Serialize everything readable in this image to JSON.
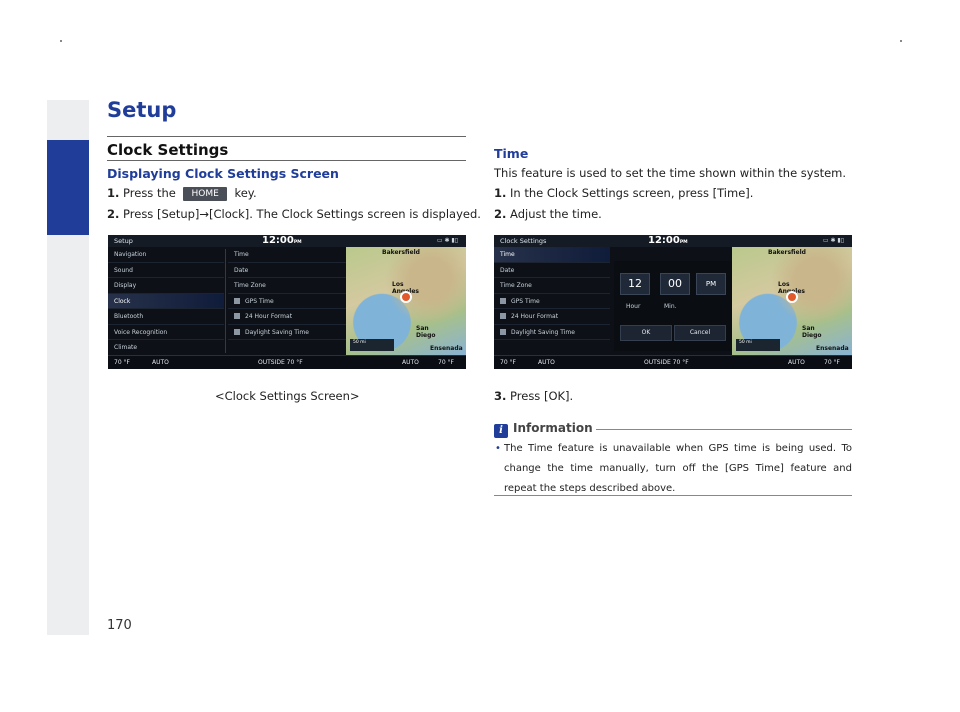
{
  "page": {
    "number": "170",
    "section": "Setup"
  },
  "left": {
    "heading": "Clock Settings",
    "subheading": "Displaying Clock Settings Screen",
    "step1": {
      "num": "1.",
      "before": "Press the",
      "key": "HOME",
      "after": "key."
    },
    "step2": {
      "num": "2.",
      "text": "Press [Setup]→[Clock]. The Clock Settings screen is displayed."
    },
    "caption": "<Clock Settings Screen>"
  },
  "screen1": {
    "title": "Setup",
    "clock": "12:00",
    "ampm": "PM",
    "menu": [
      "Navigation",
      "Sound",
      "Display",
      "Clock",
      "Bluetooth",
      "Voice Recognition",
      "Climate"
    ],
    "active_index": 3,
    "options": [
      {
        "label": "Time",
        "checkbox": false
      },
      {
        "label": "Date",
        "checkbox": false
      },
      {
        "label": "Time Zone",
        "checkbox": false
      },
      {
        "label": "GPS Time",
        "checkbox": true
      },
      {
        "label": "24 Hour Format",
        "checkbox": true
      },
      {
        "label": "Daylight Saving Time",
        "checkbox": true
      }
    ],
    "map": {
      "city1": "Bakersfield",
      "city2": "Los Angeles",
      "city3": "San Diego",
      "city4": "Ensenada",
      "scale": "50 mi"
    },
    "bottom": {
      "temp_left": "70 °F",
      "auto_left": "AUTO",
      "outside": "OUTSIDE  70 °F",
      "auto_right": "AUTO",
      "temp_right": "70 °F"
    }
  },
  "right": {
    "heading": "Time",
    "intro": "This feature is used to set the time shown within the system.",
    "step1": {
      "num": "1.",
      "text": "In the Clock Settings screen, press [Time]."
    },
    "step2": {
      "num": "2.",
      "text": "Adjust the time."
    },
    "step3": {
      "num": "3.",
      "text": "Press [OK]."
    },
    "info_title": "Information",
    "info_text": "The Time feature is unavailable when GPS time is being used. To change the time manually, turn off the [GPS Time] feature and repeat the steps described above."
  },
  "screen2": {
    "title": "Clock Settings",
    "clock": "12:00",
    "ampm": "PM",
    "options": [
      {
        "label": "Time",
        "checkbox": false
      },
      {
        "label": "Date",
        "checkbox": false
      },
      {
        "label": "Time Zone",
        "checkbox": false
      },
      {
        "label": "GPS Time",
        "checkbox": true
      },
      {
        "label": "24 Hour Format",
        "checkbox": true
      },
      {
        "label": "Daylight Saving Time",
        "checkbox": true
      }
    ],
    "picker": {
      "hour": "12",
      "minute": "00",
      "ampm": "PM",
      "hour_label": "Hour",
      "min_label": "Min.",
      "ok": "OK",
      "cancel": "Cancel"
    },
    "map": {
      "city1": "Bakersfield",
      "city2": "Los Angeles",
      "city3": "San Diego",
      "city4": "Ensenada",
      "scale": "50 mi"
    },
    "bottom": {
      "temp_left": "70 °F",
      "auto_left": "AUTO",
      "outside": "OUTSIDE  70 °F",
      "auto_right": "AUTO",
      "temp_right": "70 °F"
    }
  },
  "colors": {
    "accent": "#1f3d99",
    "sidebar": "#eceef0"
  }
}
